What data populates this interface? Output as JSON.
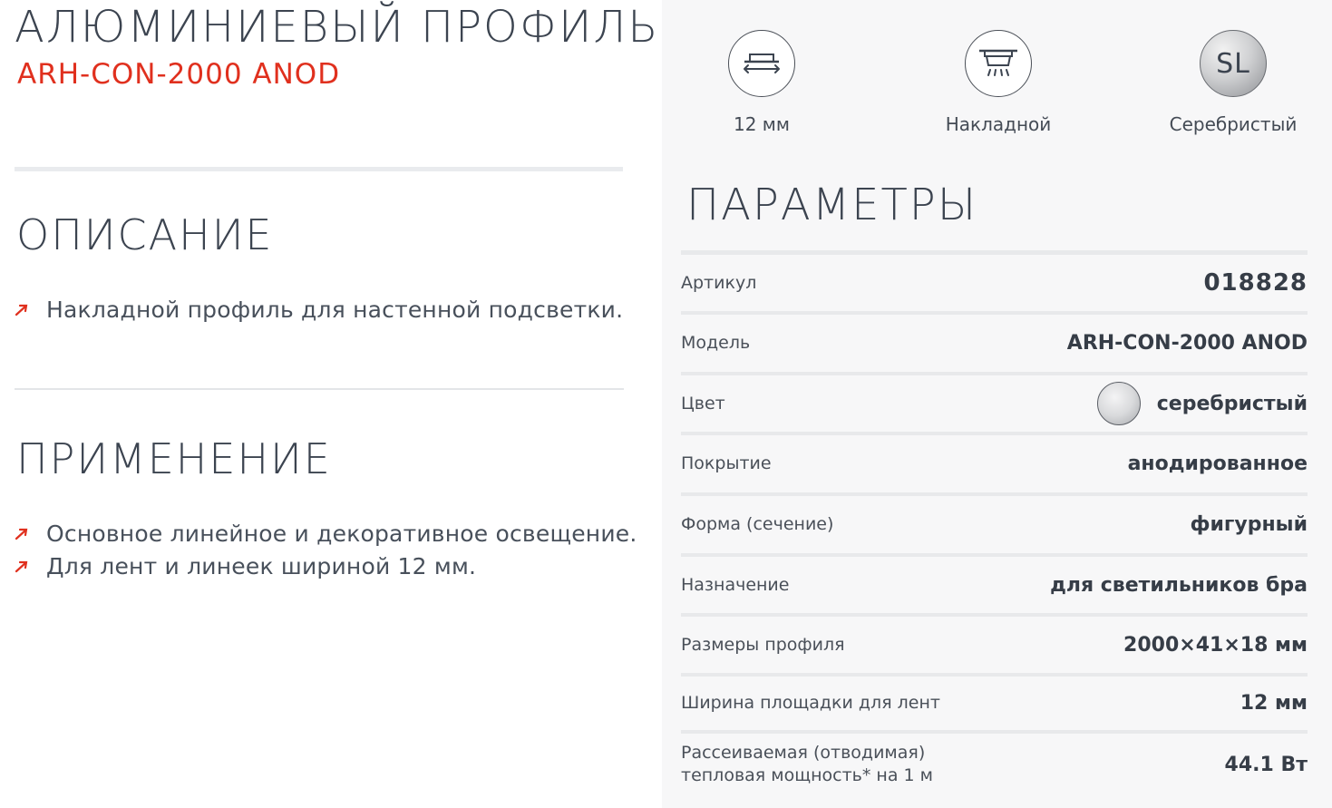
{
  "product": {
    "title": "АЛЮМИНИЕВЫЙ ПРОФИЛЬ",
    "model": "ARH-CON-2000 ANOD"
  },
  "description": {
    "title": "ОПИСАНИЕ",
    "items": [
      "Накладной профиль для настенной подсветки."
    ]
  },
  "application": {
    "title": "ПРИМЕНЕНИЕ",
    "items": [
      "Основное линейное и декоративное освещение.",
      "Для лент и линеек шириной 12 мм."
    ]
  },
  "features": [
    {
      "icon": "strip-width-icon",
      "label": "12 мм"
    },
    {
      "icon": "surface-mount-icon",
      "label": "Накладной"
    },
    {
      "icon": "silver-color-icon",
      "icon_text": "SL",
      "label": "Серебристый"
    }
  ],
  "params": {
    "title": "ПАРАМЕТРЫ",
    "rows": [
      {
        "key": "Артикул",
        "value": "018828"
      },
      {
        "key": "Модель",
        "value": "ARH-CON-2000 ANOD"
      },
      {
        "key": "Цвет",
        "value": "серебристый"
      },
      {
        "key": "Покрытие",
        "value": "анодированное"
      },
      {
        "key": "Форма (сечение)",
        "value": "фигурный"
      },
      {
        "key": "Назначение",
        "value": "для светильников бра"
      },
      {
        "key": "Размеры профиля",
        "value": "2000×41×18 мм"
      },
      {
        "key": "Ширина площадки для лент",
        "value": "12 мм"
      },
      {
        "key": "Рассеиваемая (отводимая)",
        "key_line2": "тепловая мощность* на 1 м",
        "value": "44.1 Вт"
      }
    ]
  },
  "colors": {
    "accent_red": "#e0301e",
    "text_dark": "#3c4450",
    "panel_bg": "#f7f7f8",
    "divider": "#e8e9eb"
  }
}
